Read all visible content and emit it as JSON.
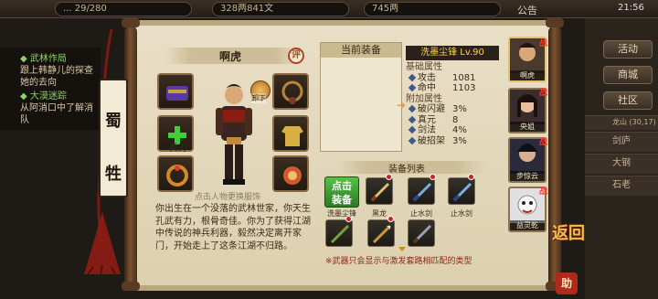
{
  "top_bar": {
    "resource1": "... 29/280",
    "resource2": "328两841文",
    "resource3": "745两",
    "notice_label": "公告",
    "clock": "21:56"
  },
  "quest": {
    "title1": "◆ 武林作局",
    "desc1": "跟上韩静儿的探查她的去向",
    "title2": "◆ 大漠迷踪",
    "desc2": "从阿消口中了解消队"
  },
  "right_panel": {
    "buttons": [
      "活动",
      "商城",
      "社区"
    ],
    "location": "龙山",
    "coords": "(30,17)",
    "list": [
      "剑庐",
      "大钢",
      "石老"
    ]
  },
  "name_banner": {
    "char1": "蜀",
    "char2": "牲"
  },
  "character": {
    "name": "啊虎",
    "eval_label": "评",
    "swap_label": "卸下",
    "hint": "点击人物更换服饰",
    "weapon_slot_label": "兵刃",
    "bio": "你出生在一个没落的武林世家，你天生孔武有力，根骨奇佳。你为了获得江湖中传说的神兵利器，毅然决定离开家门，开始走上了这条江湖不归路。"
  },
  "current_equip": {
    "header": "当前装备",
    "item_name": "洗墨尘锋 Lv.90",
    "base_title": "基础属性",
    "base_attrs": [
      {
        "name": "攻击",
        "value": "1081"
      },
      {
        "name": "命中",
        "value": "1103"
      }
    ],
    "extra_title": "附加属性",
    "extra_attrs": [
      {
        "name": "破闪避",
        "value": "3%"
      },
      {
        "name": "真元",
        "value": "8"
      },
      {
        "name": "剑法",
        "value": "4%"
      },
      {
        "name": "破招架",
        "value": "3%"
      }
    ]
  },
  "equip_list": {
    "title": "装备列表",
    "equip_button": "点击\n装备",
    "items_row1": [
      "洗墨尘锋",
      "黑龙",
      "止水剑",
      "止水剑"
    ],
    "footer": "※武器只会显示与激发套路相匹配的类型"
  },
  "roster": [
    {
      "name": "啊虎",
      "war": "战"
    },
    {
      "name": "央姐",
      "war": "战"
    },
    {
      "name": "步惊云",
      "war": "战"
    },
    {
      "name": "益灵乾",
      "war": "战"
    }
  ],
  "back_label": "返回",
  "seal_text": "助",
  "colors": {
    "paper": "#e9dfc6",
    "equip_button": "#3a9a2e",
    "highlight": "#ffd24a",
    "war": "#ff3a2a"
  }
}
